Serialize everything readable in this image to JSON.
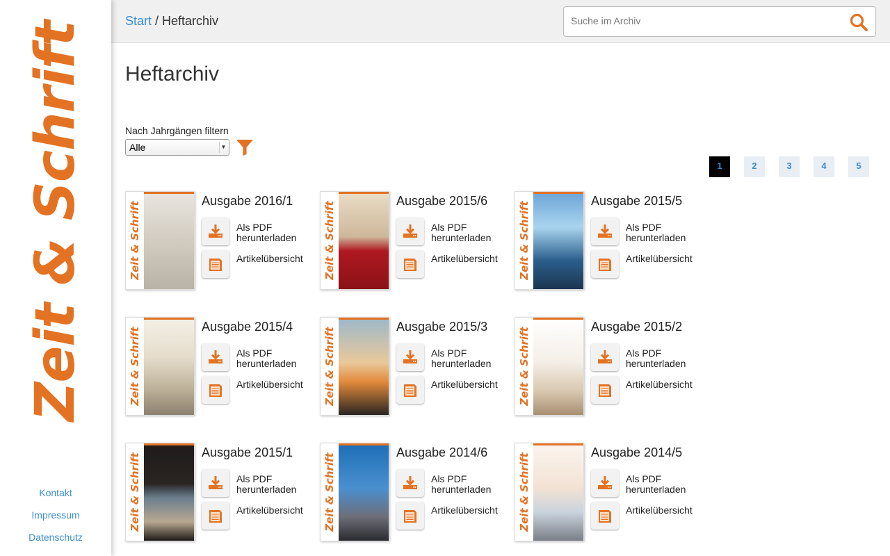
{
  "sidebar": {
    "logo": "Zeit & Schrift",
    "links": [
      {
        "label": "Kontakt"
      },
      {
        "label": "Impressum"
      },
      {
        "label": "Datenschutz"
      }
    ]
  },
  "header": {
    "breadcrumb": {
      "home": "Start",
      "separator": " / ",
      "current": "Heftarchiv"
    },
    "search": {
      "placeholder": "Suche im Archiv"
    }
  },
  "main": {
    "title": "Heftarchiv",
    "filter": {
      "label": "Nach Jahrgängen filtern",
      "selected": "Alle"
    },
    "pagination": [
      {
        "label": "1",
        "active": true
      },
      {
        "label": "2",
        "active": false
      },
      {
        "label": "3",
        "active": false
      },
      {
        "label": "4",
        "active": false
      },
      {
        "label": "5",
        "active": false
      }
    ],
    "issues": [
      {
        "title": "Ausgabe 2016/1",
        "pdf": "Als PDF herunterladen",
        "overview": "Artikelübersicht",
        "cover_spine": "Zeit & Schrift"
      },
      {
        "title": "Ausgabe 2015/6",
        "pdf": "Als PDF herunterladen",
        "overview": "Artikelübersicht",
        "cover_spine": "Zeit & Schrift"
      },
      {
        "title": "Ausgabe 2015/5",
        "pdf": "Als PDF herunterladen",
        "overview": "Artikelübersicht",
        "cover_spine": "Zeit & Schrift"
      },
      {
        "title": "Ausgabe 2015/4",
        "pdf": "Als PDF herunterladen",
        "overview": "Artikelübersicht",
        "cover_spine": "Zeit & Schrift"
      },
      {
        "title": "Ausgabe 2015/3",
        "pdf": "Als PDF herunterladen",
        "overview": "Artikelübersicht",
        "cover_spine": "Zeit & Schrift"
      },
      {
        "title": "Ausgabe 2015/2",
        "pdf": "Als PDF herunterladen",
        "overview": "Artikelübersicht",
        "cover_spine": "Zeit & Schrift"
      },
      {
        "title": "Ausgabe 2015/1",
        "pdf": "Als PDF herunterladen",
        "overview": "Artikelübersicht",
        "cover_spine": "Zeit & Schrift"
      },
      {
        "title": "Ausgabe 2014/6",
        "pdf": "Als PDF herunterladen",
        "overview": "Artikelübersicht",
        "cover_spine": "Zeit & Schrift"
      },
      {
        "title": "Ausgabe 2014/5",
        "pdf": "Als PDF herunterladen",
        "overview": "Artikelübersicht",
        "cover_spine": "Zeit & Schrift"
      }
    ]
  },
  "colors": {
    "accent": "#e37222",
    "link": "#3a8dd3"
  },
  "icons": {
    "search": "search-icon",
    "filter": "filter-icon",
    "download": "download-icon",
    "overview": "document-icon"
  }
}
